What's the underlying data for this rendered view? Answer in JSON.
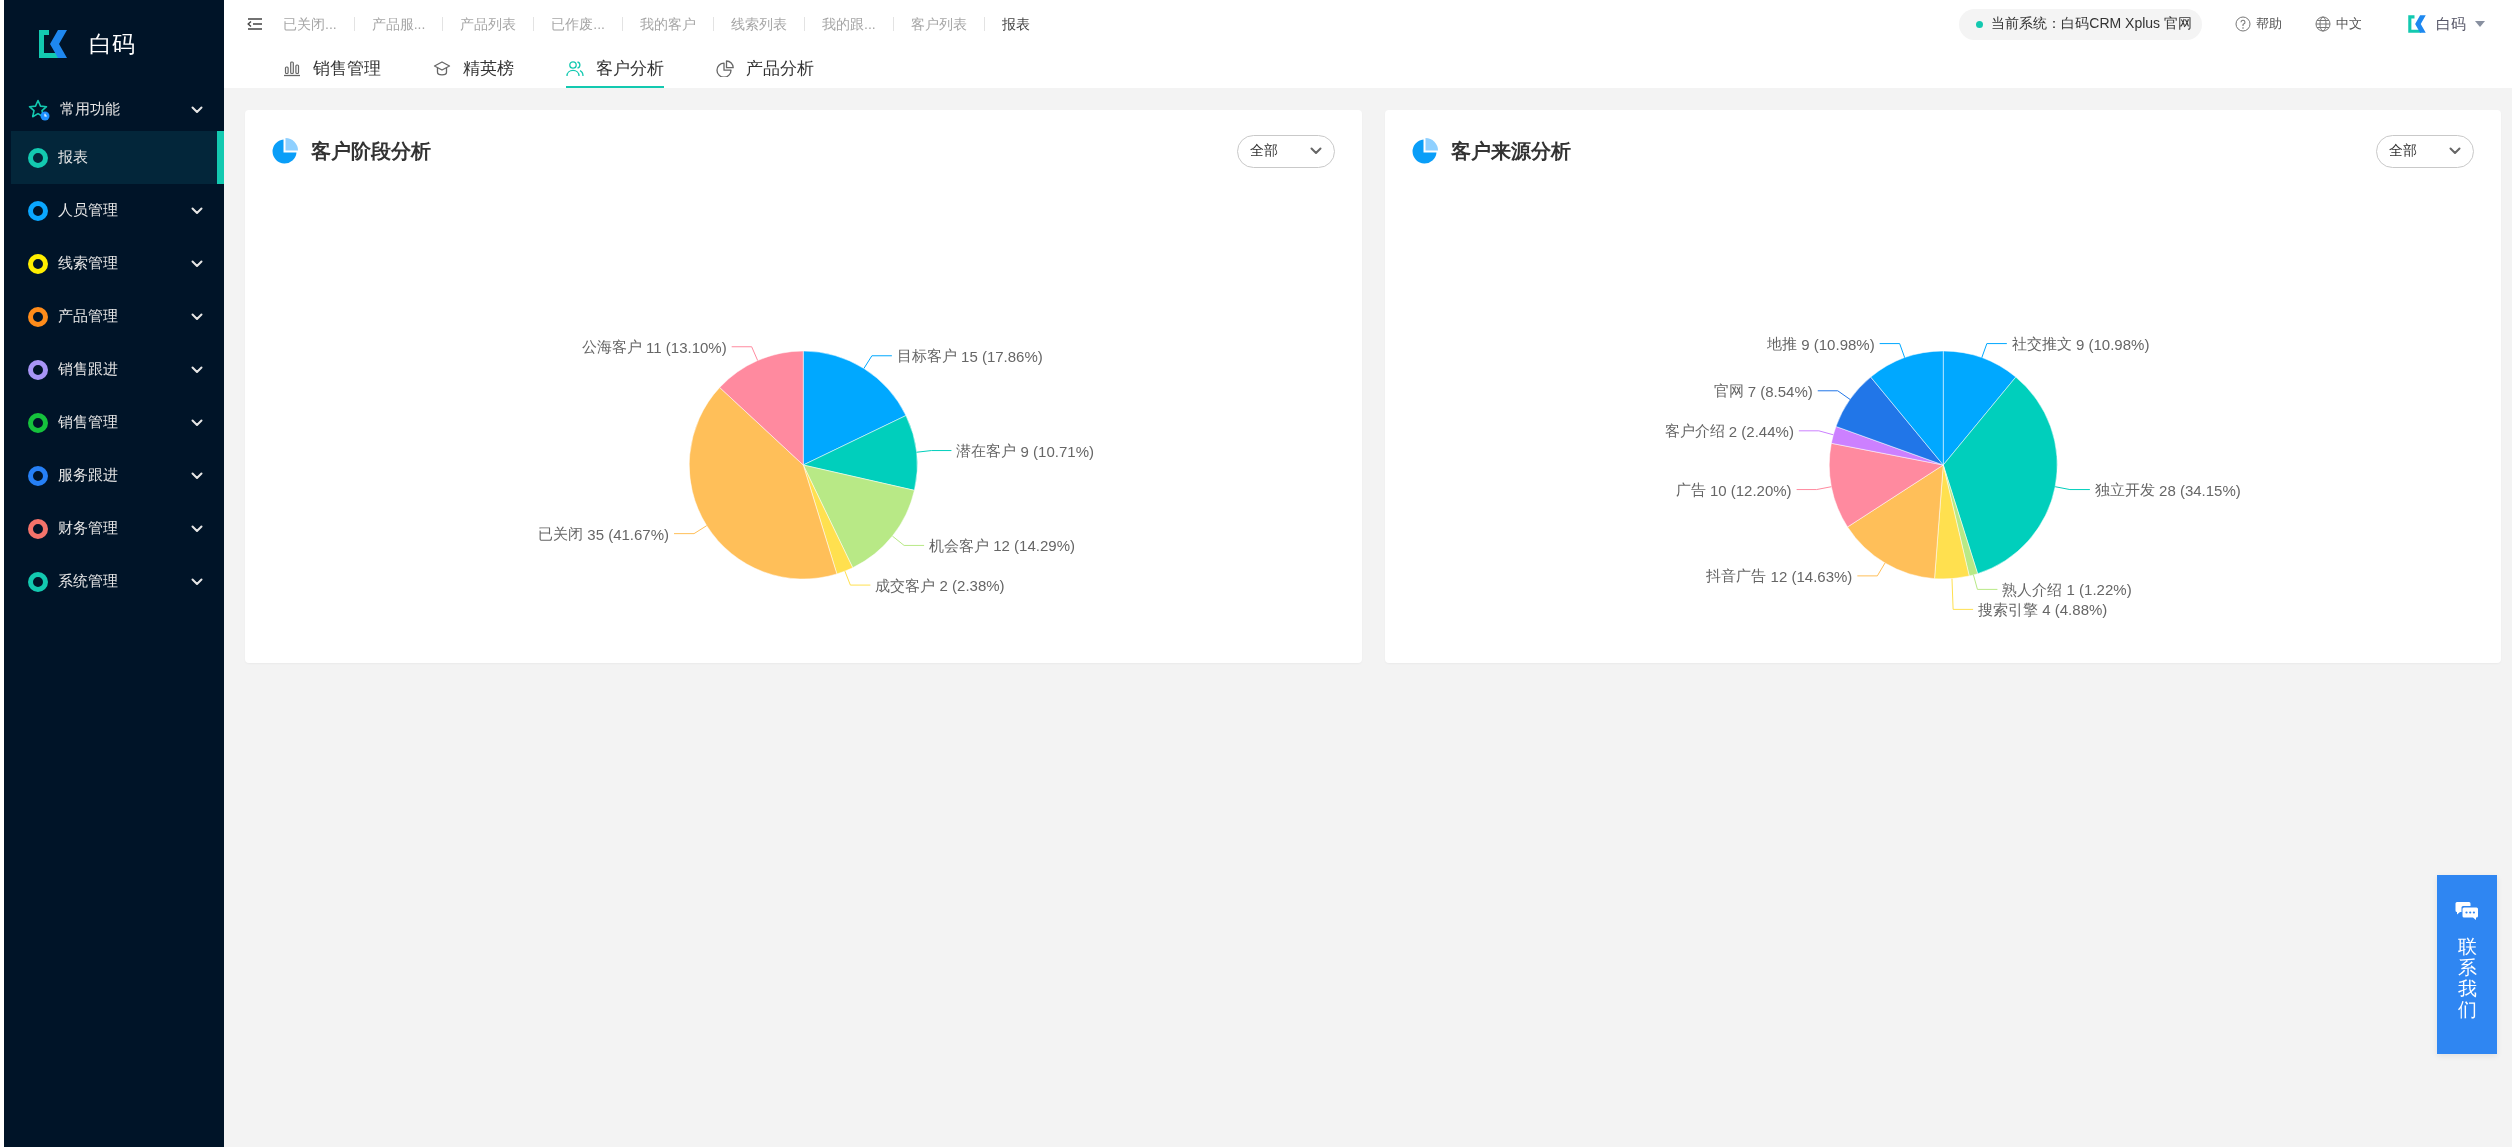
{
  "sidebar": {
    "brand": "白码",
    "favorites": {
      "label": "常用功能",
      "expanded": false
    },
    "items": [
      {
        "label": "报表",
        "kind": "page",
        "color": "#13c9b0",
        "selected": true
      },
      {
        "label": "人员管理",
        "kind": "group",
        "color": "#0aa7ff",
        "selected": false,
        "expanded": false
      },
      {
        "label": "线索管理",
        "kind": "group",
        "color": "#ffee00",
        "selected": false,
        "expanded": false
      },
      {
        "label": "产品管理",
        "kind": "group",
        "color": "#ff8c1a",
        "selected": false,
        "expanded": false
      },
      {
        "label": "销售跟进",
        "kind": "group",
        "color": "#a895f7",
        "selected": false,
        "expanded": false
      },
      {
        "label": "销售管理",
        "kind": "group",
        "color": "#15c23c",
        "selected": false,
        "expanded": false
      },
      {
        "label": "服务跟进",
        "kind": "group",
        "color": "#2680f6",
        "selected": false,
        "expanded": false
      },
      {
        "label": "财务管理",
        "kind": "group",
        "color": "#f4736a",
        "selected": false,
        "expanded": false
      },
      {
        "label": "系统管理",
        "kind": "group",
        "color": "#13c9b0",
        "selected": false,
        "expanded": false
      }
    ]
  },
  "header": {
    "open_tabs": [
      {
        "label": "已关闭...",
        "selected": false
      },
      {
        "label": "产品服...",
        "selected": false
      },
      {
        "label": "产品列表",
        "selected": false
      },
      {
        "label": "已作废...",
        "selected": false
      },
      {
        "label": "我的客户",
        "selected": false
      },
      {
        "label": "线索列表",
        "selected": false
      },
      {
        "label": "我的跟...",
        "selected": false
      },
      {
        "label": "客户列表",
        "selected": false
      },
      {
        "label": "报表",
        "selected": true
      }
    ],
    "system": "当前系统：白码CRM Xplus 官网",
    "help": "帮助",
    "language": "中文",
    "user": "白码"
  },
  "report_tabs": [
    {
      "label": "销售管理",
      "selected": false
    },
    {
      "label": "精英榜",
      "selected": false
    },
    {
      "label": "客户分析",
      "selected": true
    },
    {
      "label": "产品分析",
      "selected": false
    }
  ],
  "panels": [
    {
      "title": "客户阶段分析",
      "filter": {
        "value": "全部"
      },
      "chart_data": {
        "type": "pie",
        "categories": [
          "目标客户",
          "潜在客户",
          "机会客户",
          "成交客户",
          "已关闭",
          "公海客户"
        ],
        "values": [
          15,
          9,
          12,
          2,
          35,
          11
        ],
        "value_labels": [
          "15 (17.86%)",
          "9 (10.71%)",
          "12 (14.29%)",
          "2 (2.38%)",
          "35 (41.67%)",
          "11 (13.10%)"
        ]
      }
    },
    {
      "title": "客户来源分析",
      "filter": {
        "value": "全部"
      },
      "chart_data": {
        "type": "pie",
        "categories": [
          "社交推文",
          "独立开发",
          "熟人介绍",
          "搜索引擎",
          "抖音广告",
          "广告",
          "客户介绍",
          "官网",
          "地推"
        ],
        "values": [
          9,
          28,
          1,
          4,
          12,
          10,
          2,
          7,
          9
        ],
        "value_labels": [
          "9 (10.98%)",
          "28 (34.15%)",
          "1 (1.22%)",
          "4 (4.88%)",
          "12 (14.63%)",
          "10 (12.20%)",
          "2 (2.44%)",
          "7 (8.54%)",
          "9 (10.98%)"
        ]
      }
    }
  ],
  "contact": {
    "label": "联系我们"
  }
}
